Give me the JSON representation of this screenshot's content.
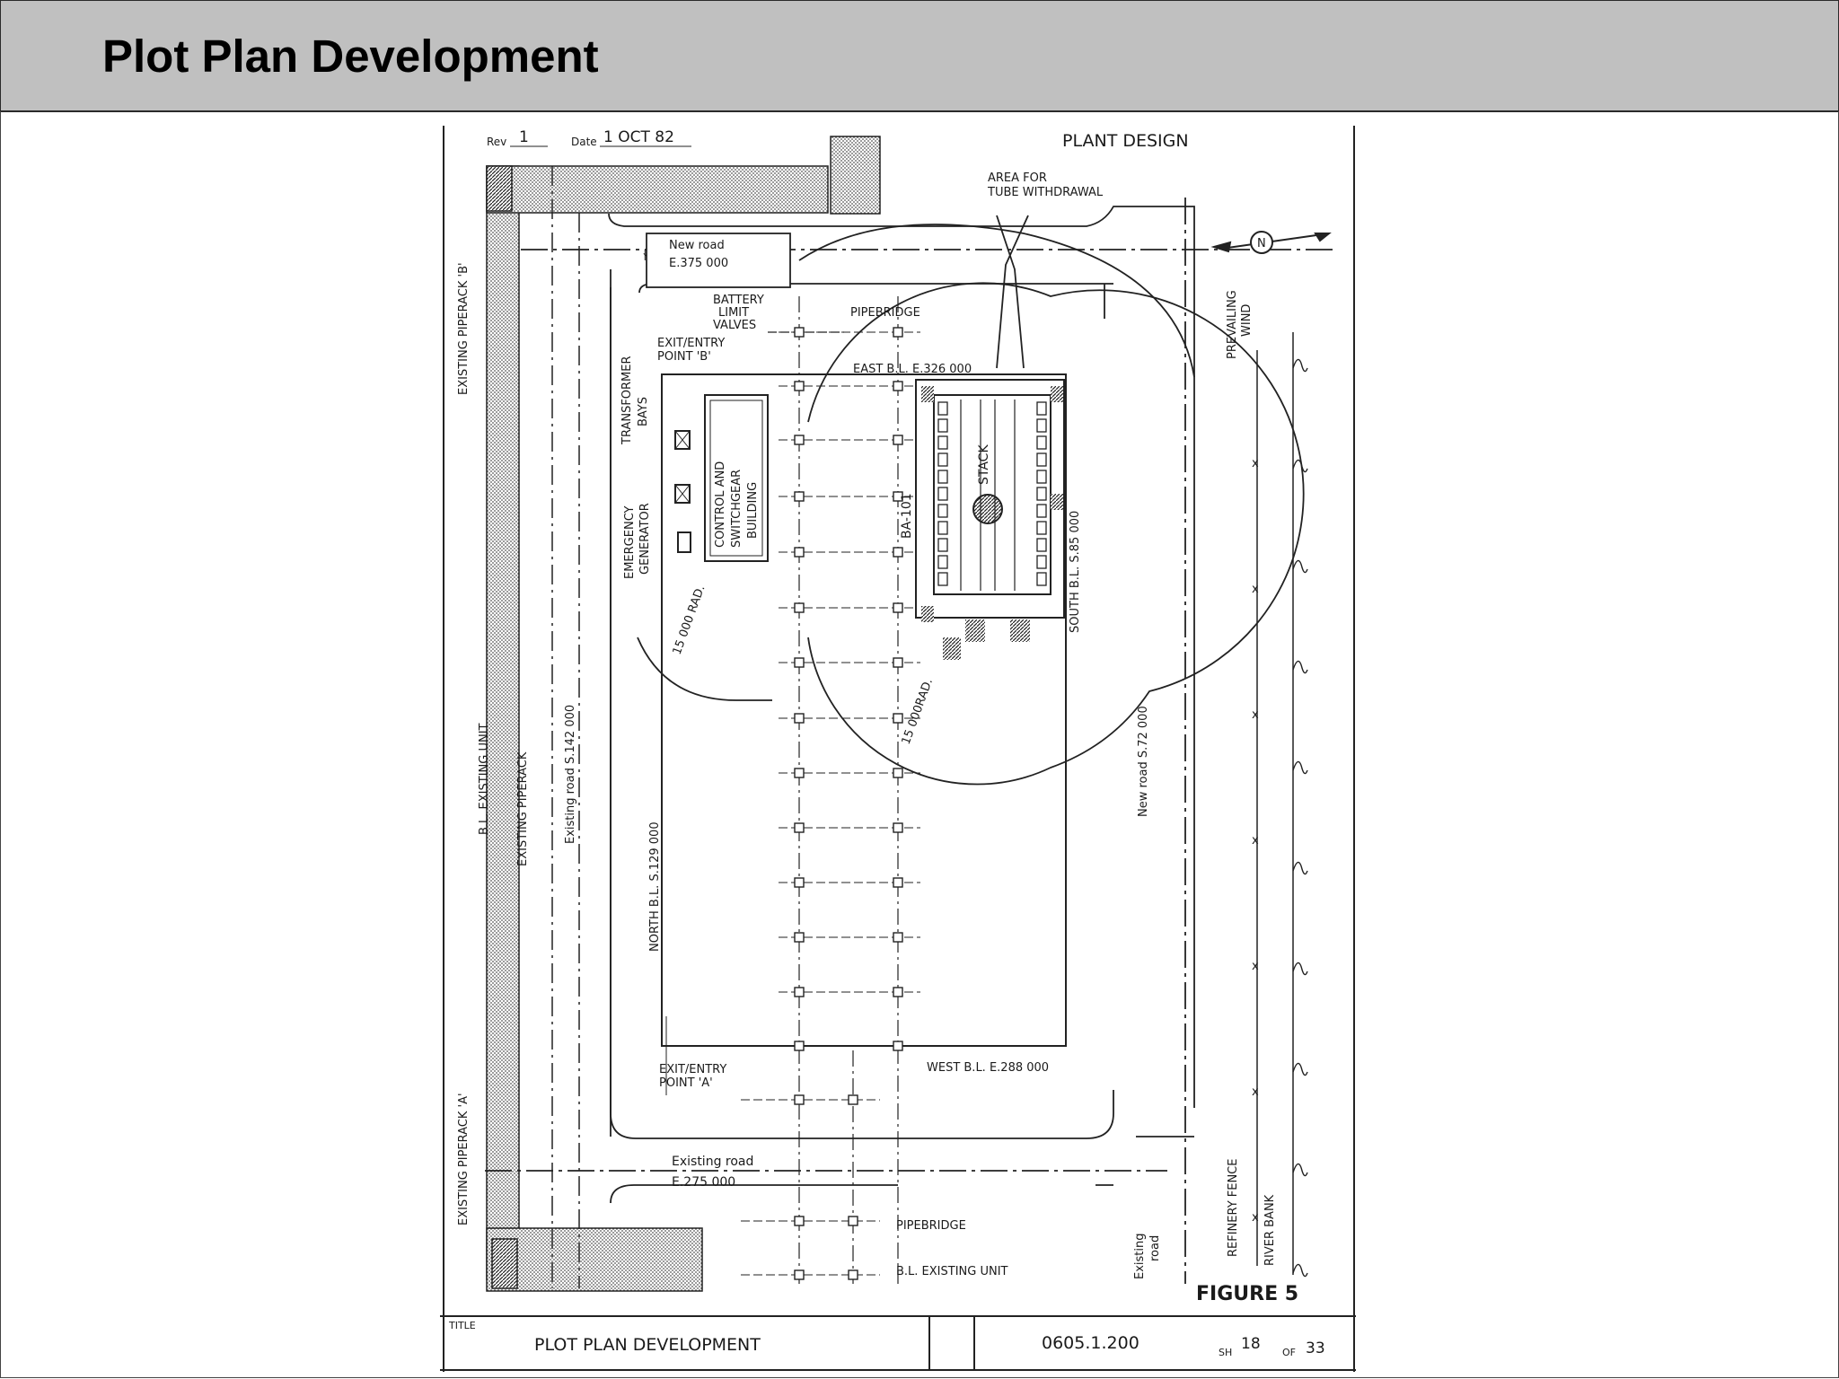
{
  "page": {
    "title": "Plot Plan Development"
  },
  "drawing": {
    "header": {
      "rev_label": "Rev",
      "rev": "1",
      "date_label": "Date",
      "date": "1 OCT 82",
      "design": "PLANT DESIGN"
    },
    "labels": {
      "tube_area": [
        "AREA FOR",
        "TUBE WITHDRAWAL"
      ],
      "new_road_north": "New road",
      "new_road_north_e": "E.375 000",
      "battery_limit": [
        "BATTERY",
        "LIMIT",
        "VALVES"
      ],
      "pipebridge_top": "PIPEBRIDGE",
      "exit_b": [
        "EXIT/ENTRY",
        "POINT 'B'"
      ],
      "east_bl": "EAST B.L. E.326 000",
      "transformer": [
        "TRANSFORMER",
        "BAYS"
      ],
      "control_building": [
        "CONTROL AND",
        "SWITCHGEAR",
        "BUILDING"
      ],
      "emergency": [
        "EMERGENCY",
        "GENERATOR"
      ],
      "ba101": "BA-101",
      "stack": "STACK",
      "south_bl": "SOUTH B.L. S.85 000",
      "rad_left": "15 000 RAD.",
      "rad_right": "15 000RAD.",
      "new_road_south": "New road S.72 000",
      "north_bl": "NORTH B.L. S.129 000",
      "existing_road_s": "Existing road S.142 000",
      "existing_pipe_rack": "EXISTING PIPERACK",
      "bl_existing_unit_v": "B.L. EXISTING UNIT",
      "existing_piperack_b": "EXISTING PIPERACK 'B'",
      "existing_piperack_a": "EXISTING PIPERACK 'A'",
      "exit_a": [
        "EXIT/ENTRY",
        "POINT 'A'"
      ],
      "west_bl": "WEST B.L. E.288 000",
      "existing_road": "Existing road",
      "existing_road_e": "E.275 000",
      "pipebridge_bottom": "PIPEBRIDGE",
      "bl_existing_unit_h": "B.L. EXISTING UNIT",
      "existing_road_v": [
        "Existing",
        "road"
      ],
      "prevailing_wind": [
        "PREVAILING",
        "WIND"
      ],
      "north_marker": "N",
      "refinery_fence": "REFINERY FENCE",
      "river_bank": "RIVER BANK",
      "figure": "FIGURE 5"
    },
    "title_block": {
      "title_label": "TITLE",
      "title": "PLOT PLAN DEVELOPMENT",
      "number": "0605.1.200",
      "sheet_label": "SH",
      "sheet": "18",
      "of_label": "OF",
      "total": "33"
    }
  }
}
